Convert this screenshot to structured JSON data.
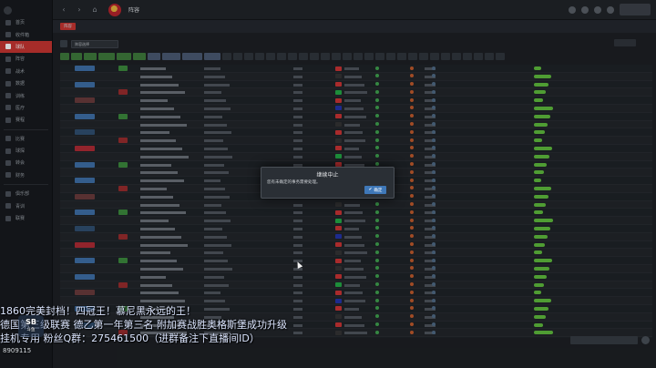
{
  "sidebar": {
    "items": [
      {
        "label": "首页",
        "active": false
      },
      {
        "label": "收件箱",
        "active": false
      },
      {
        "label": "球队",
        "active": true
      },
      {
        "label": "阵容",
        "active": false
      },
      {
        "label": "战术",
        "active": false
      },
      {
        "label": "数据",
        "active": false
      },
      {
        "label": "训练",
        "active": false
      },
      {
        "label": "医疗",
        "active": false
      },
      {
        "label": "赛程",
        "active": false
      },
      {
        "label": "比赛",
        "active": false
      },
      {
        "label": "球探",
        "active": false
      },
      {
        "label": "转会",
        "active": false
      },
      {
        "label": "财务",
        "active": false
      },
      {
        "label": "俱乐部",
        "active": false
      },
      {
        "label": "青训",
        "active": false
      },
      {
        "label": "联赛",
        "active": false
      }
    ]
  },
  "topbar": {
    "title": "阵容"
  },
  "subbar": {
    "tab": "阵容"
  },
  "toolbar": {
    "view_dropdown": "阵容选择"
  },
  "modal": {
    "title": "继续中止",
    "message": "您有未确定的事务需要处理。",
    "ok_label": "确定"
  },
  "overlay": {
    "line1": "1860完美封档！四冠王！慕尼黑永远的王！",
    "line2": "德国第三级联赛 德乙第一年第三名 附加赛战胜奥格斯堡成功升级",
    "line3": "挂机专用 粉丝Q群：275461500（进群备注下直播间ID）",
    "logo_main": "SB",
    "logo_sub": "斗鱼",
    "room_id": "8909115"
  },
  "colors": {
    "accent_red": "#c8342f",
    "rating_green": "#5fbd3b",
    "ok_blue": "#3f78b8"
  }
}
